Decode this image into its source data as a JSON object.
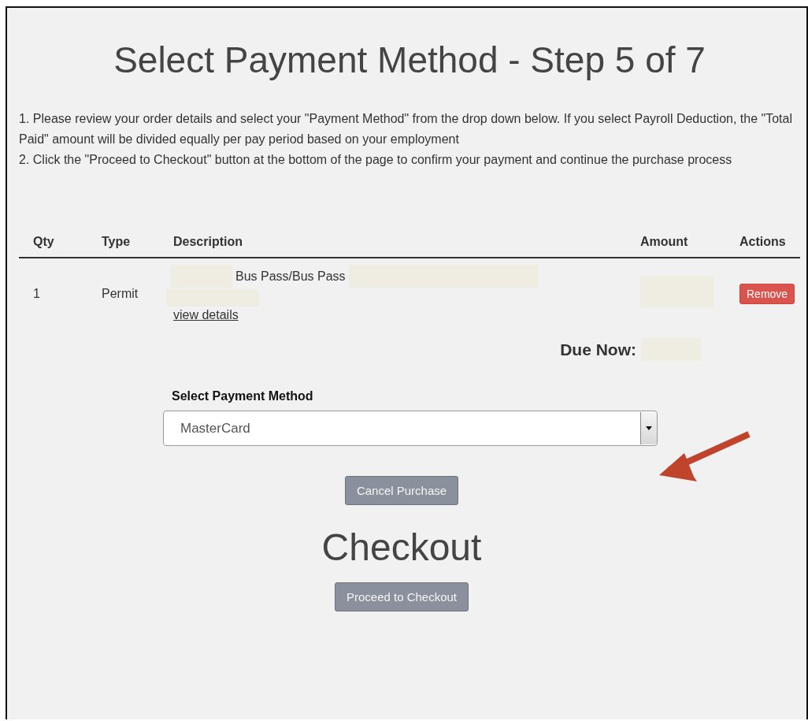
{
  "title": "Select Payment Method - Step 5 of 7",
  "instructions": [
    "1. Please review your order details and select your \"Payment Method\" from the drop down below. If you select Payroll Deduction, the \"Total Paid\" amount will be divided equally per pay period based on your employment",
    "2. Click the \"Proceed to Checkout\" button at the bottom of the page to confirm your payment and continue the purchase process"
  ],
  "table": {
    "columns": [
      "Qty",
      "Type",
      "Description",
      "Amount",
      "Actions"
    ],
    "rows": [
      {
        "qty": "1",
        "type": "Permit",
        "description": "Bus Pass/Bus Pass",
        "link": "view details",
        "action": "Remove"
      }
    ]
  },
  "due_now": {
    "label": "Due Now:"
  },
  "payment": {
    "label": "Select Payment Method",
    "value": "MasterCard"
  },
  "cancel_button": "Cancel Purchase",
  "checkout_heading": "Checkout",
  "proceed_button": "Proceed to Checkout"
}
